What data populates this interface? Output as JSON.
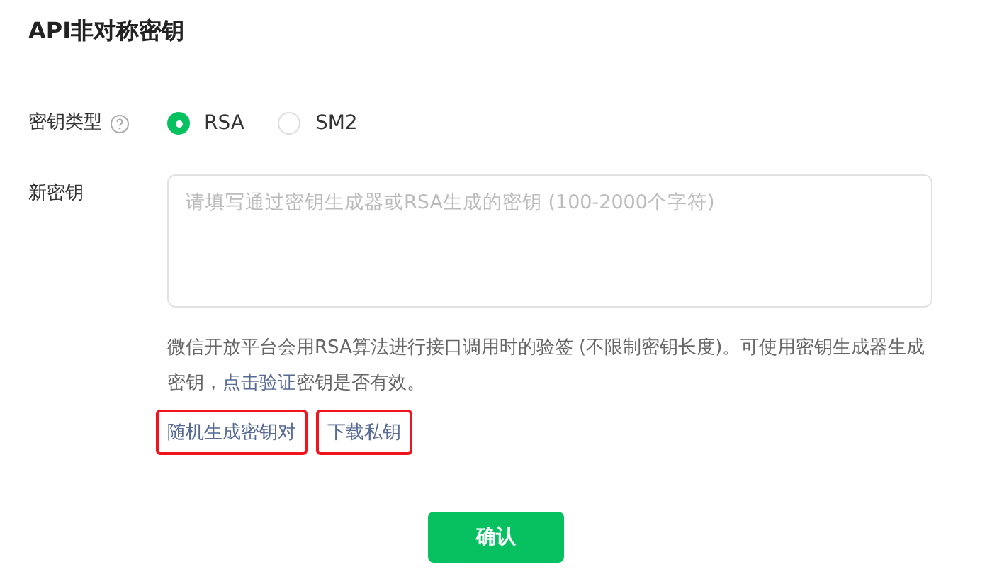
{
  "title": "API非对称密钥",
  "key_type": {
    "label": "密钥类型",
    "options": [
      {
        "label": "RSA",
        "selected": true
      },
      {
        "label": "SM2",
        "selected": false
      }
    ]
  },
  "new_key": {
    "label": "新密钥",
    "placeholder": "请填写通过密钥生成器或RSA生成的密钥 (100-2000个字符)"
  },
  "hint": {
    "before": "微信开放平台会用RSA算法进行接口调用时的验签 (不限制密钥长度)。可使用密钥生成器生成密钥，",
    "link": "点击验证",
    "after": "密钥是否有效。"
  },
  "actions": [
    {
      "label": "随机生成密钥对",
      "highlighted": true
    },
    {
      "label": "下载私钥",
      "highlighted": true
    }
  ],
  "confirm": "确认"
}
